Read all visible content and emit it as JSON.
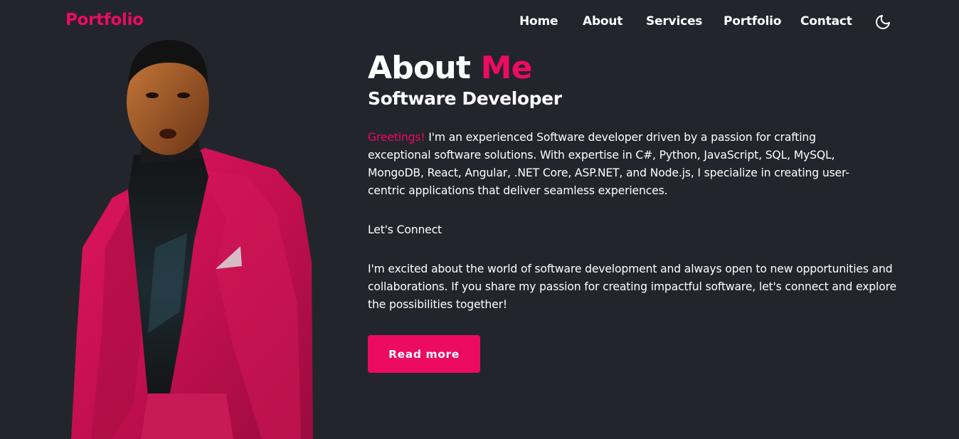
{
  "header": {
    "logo": "Portfolio",
    "nav": [
      "Home",
      "About",
      "Services",
      "Portfolio",
      "Contact"
    ],
    "theme_icon": "moon-icon"
  },
  "about": {
    "title_main": "About",
    "title_accent": "Me",
    "subtitle": "Software Developer",
    "greeting": "Greetings!",
    "paragraph1": " I'm an experienced Software developer driven by a passion for crafting exceptional software solutions. With expertise in C#, Python, JavaScript, SQL, MySQL, MongoDB, React, Angular, .NET Core, ASP.NET, and Node.js, I specialize in creating user-centric applications that deliver seamless experiences.",
    "connect": "Let's Connect",
    "paragraph2": "I'm excited about the world of software development and always open to new opportunities and collaborations. If you share my passion for creating impactful software, let's connect and explore the possibilities together!",
    "button": "Read more"
  },
  "colors": {
    "accent": "#ec0b61",
    "background": "#23252c",
    "text": "#ffffff"
  }
}
